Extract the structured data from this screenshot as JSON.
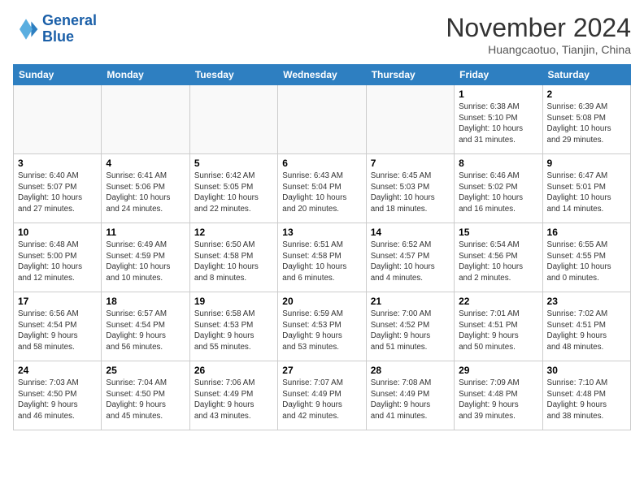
{
  "header": {
    "logo_line1": "General",
    "logo_line2": "Blue",
    "month": "November 2024",
    "location": "Huangcaotuo, Tianjin, China"
  },
  "weekdays": [
    "Sunday",
    "Monday",
    "Tuesday",
    "Wednesday",
    "Thursday",
    "Friday",
    "Saturday"
  ],
  "weeks": [
    [
      {
        "day": "",
        "info": ""
      },
      {
        "day": "",
        "info": ""
      },
      {
        "day": "",
        "info": ""
      },
      {
        "day": "",
        "info": ""
      },
      {
        "day": "",
        "info": ""
      },
      {
        "day": "1",
        "info": "Sunrise: 6:38 AM\nSunset: 5:10 PM\nDaylight: 10 hours\nand 31 minutes."
      },
      {
        "day": "2",
        "info": "Sunrise: 6:39 AM\nSunset: 5:08 PM\nDaylight: 10 hours\nand 29 minutes."
      }
    ],
    [
      {
        "day": "3",
        "info": "Sunrise: 6:40 AM\nSunset: 5:07 PM\nDaylight: 10 hours\nand 27 minutes."
      },
      {
        "day": "4",
        "info": "Sunrise: 6:41 AM\nSunset: 5:06 PM\nDaylight: 10 hours\nand 24 minutes."
      },
      {
        "day": "5",
        "info": "Sunrise: 6:42 AM\nSunset: 5:05 PM\nDaylight: 10 hours\nand 22 minutes."
      },
      {
        "day": "6",
        "info": "Sunrise: 6:43 AM\nSunset: 5:04 PM\nDaylight: 10 hours\nand 20 minutes."
      },
      {
        "day": "7",
        "info": "Sunrise: 6:45 AM\nSunset: 5:03 PM\nDaylight: 10 hours\nand 18 minutes."
      },
      {
        "day": "8",
        "info": "Sunrise: 6:46 AM\nSunset: 5:02 PM\nDaylight: 10 hours\nand 16 minutes."
      },
      {
        "day": "9",
        "info": "Sunrise: 6:47 AM\nSunset: 5:01 PM\nDaylight: 10 hours\nand 14 minutes."
      }
    ],
    [
      {
        "day": "10",
        "info": "Sunrise: 6:48 AM\nSunset: 5:00 PM\nDaylight: 10 hours\nand 12 minutes."
      },
      {
        "day": "11",
        "info": "Sunrise: 6:49 AM\nSunset: 4:59 PM\nDaylight: 10 hours\nand 10 minutes."
      },
      {
        "day": "12",
        "info": "Sunrise: 6:50 AM\nSunset: 4:58 PM\nDaylight: 10 hours\nand 8 minutes."
      },
      {
        "day": "13",
        "info": "Sunrise: 6:51 AM\nSunset: 4:58 PM\nDaylight: 10 hours\nand 6 minutes."
      },
      {
        "day": "14",
        "info": "Sunrise: 6:52 AM\nSunset: 4:57 PM\nDaylight: 10 hours\nand 4 minutes."
      },
      {
        "day": "15",
        "info": "Sunrise: 6:54 AM\nSunset: 4:56 PM\nDaylight: 10 hours\nand 2 minutes."
      },
      {
        "day": "16",
        "info": "Sunrise: 6:55 AM\nSunset: 4:55 PM\nDaylight: 10 hours\nand 0 minutes."
      }
    ],
    [
      {
        "day": "17",
        "info": "Sunrise: 6:56 AM\nSunset: 4:54 PM\nDaylight: 9 hours\nand 58 minutes."
      },
      {
        "day": "18",
        "info": "Sunrise: 6:57 AM\nSunset: 4:54 PM\nDaylight: 9 hours\nand 56 minutes."
      },
      {
        "day": "19",
        "info": "Sunrise: 6:58 AM\nSunset: 4:53 PM\nDaylight: 9 hours\nand 55 minutes."
      },
      {
        "day": "20",
        "info": "Sunrise: 6:59 AM\nSunset: 4:53 PM\nDaylight: 9 hours\nand 53 minutes."
      },
      {
        "day": "21",
        "info": "Sunrise: 7:00 AM\nSunset: 4:52 PM\nDaylight: 9 hours\nand 51 minutes."
      },
      {
        "day": "22",
        "info": "Sunrise: 7:01 AM\nSunset: 4:51 PM\nDaylight: 9 hours\nand 50 minutes."
      },
      {
        "day": "23",
        "info": "Sunrise: 7:02 AM\nSunset: 4:51 PM\nDaylight: 9 hours\nand 48 minutes."
      }
    ],
    [
      {
        "day": "24",
        "info": "Sunrise: 7:03 AM\nSunset: 4:50 PM\nDaylight: 9 hours\nand 46 minutes."
      },
      {
        "day": "25",
        "info": "Sunrise: 7:04 AM\nSunset: 4:50 PM\nDaylight: 9 hours\nand 45 minutes."
      },
      {
        "day": "26",
        "info": "Sunrise: 7:06 AM\nSunset: 4:49 PM\nDaylight: 9 hours\nand 43 minutes."
      },
      {
        "day": "27",
        "info": "Sunrise: 7:07 AM\nSunset: 4:49 PM\nDaylight: 9 hours\nand 42 minutes."
      },
      {
        "day": "28",
        "info": "Sunrise: 7:08 AM\nSunset: 4:49 PM\nDaylight: 9 hours\nand 41 minutes."
      },
      {
        "day": "29",
        "info": "Sunrise: 7:09 AM\nSunset: 4:48 PM\nDaylight: 9 hours\nand 39 minutes."
      },
      {
        "day": "30",
        "info": "Sunrise: 7:10 AM\nSunset: 4:48 PM\nDaylight: 9 hours\nand 38 minutes."
      }
    ]
  ]
}
